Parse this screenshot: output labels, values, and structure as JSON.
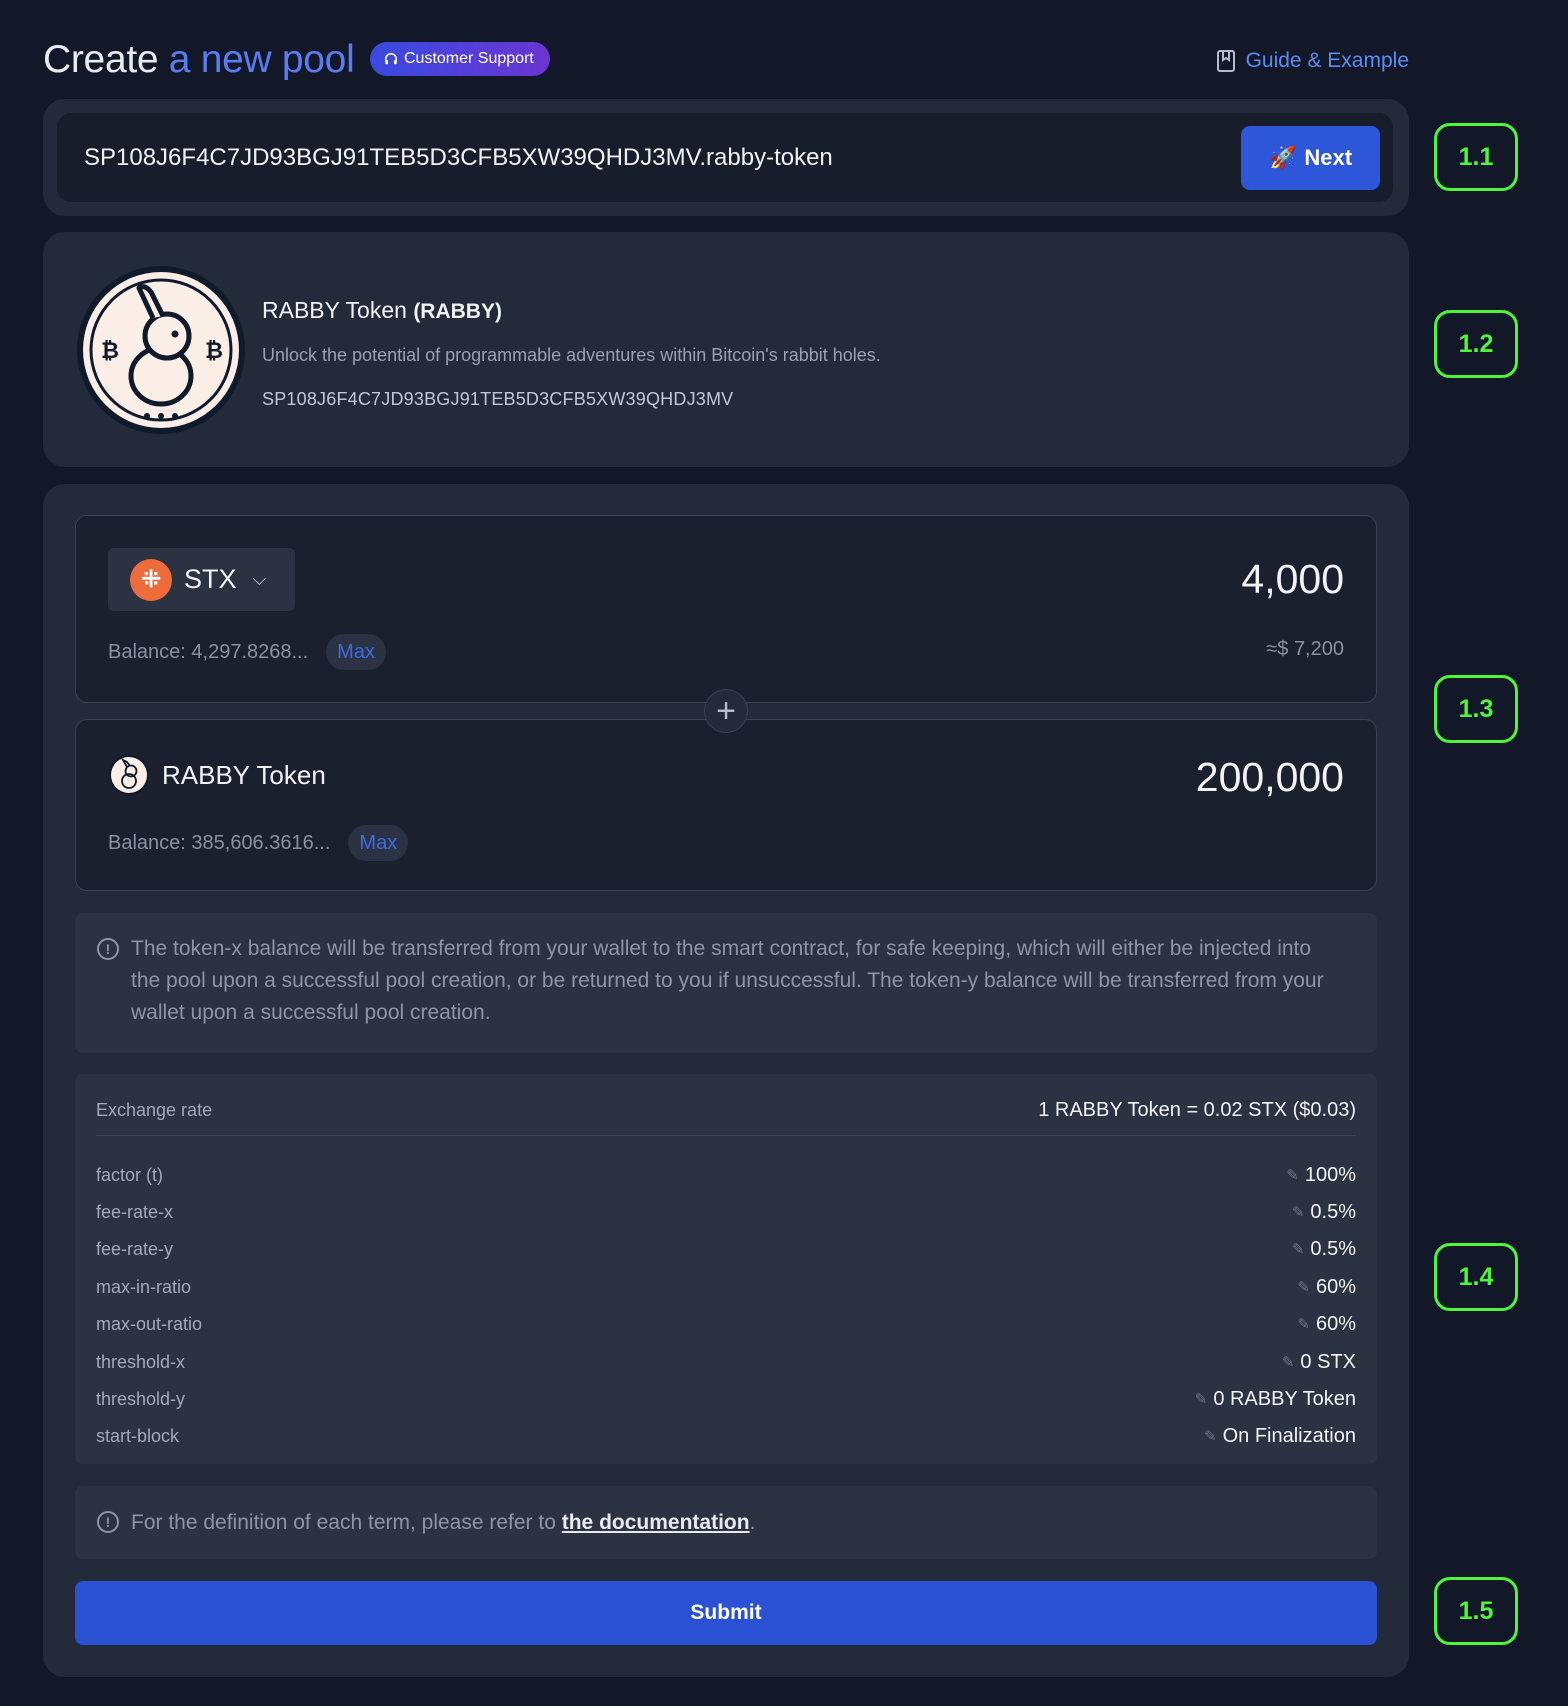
{
  "header": {
    "title_part1": "Create ",
    "title_part2": "a new pool",
    "support_label": "Customer Support",
    "guide_label": "Guide & Example"
  },
  "address_card": {
    "contract_value": "SP108J6F4C7JD93BGJ91TEB5D3CFB5XW39QHDJ3MV.rabby-token",
    "next_label": "Next"
  },
  "token_info": {
    "name": "RABBY Token",
    "symbol": "(RABBY)",
    "description": "Unlock the potential of programmable adventures within Bitcoin's rabbit holes.",
    "address": "SP108J6F4C7JD93BGJ91TEB5D3CFB5XW39QHDJ3MV"
  },
  "token_x": {
    "symbol": "STX",
    "amount": "4,000",
    "balance": "Balance: 4,297.8268...",
    "max_label": "Max",
    "usd_value": "≈$ 7,200"
  },
  "token_y": {
    "name": "RABBY Token",
    "amount": "200,000",
    "balance": "Balance: 385,606.3616...",
    "max_label": "Max"
  },
  "notice_transfer": "The token-x balance will be transferred from your wallet to the smart contract, for safe keeping, which will either be injected into the pool upon a successful pool creation, or be returned to you if unsuccessful. The token-y balance will be transferred from your wallet upon a successful pool creation.",
  "exchange": {
    "label": "Exchange rate",
    "value": "1 RABBY Token = 0.02 STX ($0.03)"
  },
  "params": [
    {
      "label": "factor (t)",
      "value": "100%"
    },
    {
      "label": "fee-rate-x",
      "value": "0.5%"
    },
    {
      "label": "fee-rate-y",
      "value": "0.5%"
    },
    {
      "label": "max-in-ratio",
      "value": "60%"
    },
    {
      "label": "max-out-ratio",
      "value": "60%"
    },
    {
      "label": "threshold-x",
      "value": "0 STX"
    },
    {
      "label": "threshold-y",
      "value": "0 RABBY Token"
    },
    {
      "label": "start-block",
      "value": "On Finalization"
    }
  ],
  "notice_doc": {
    "prefix": "For the definition of each term, please refer to ",
    "link": "the documentation",
    "suffix": "."
  },
  "submit_label": "Submit",
  "steps": [
    "1.1",
    "1.2",
    "1.3",
    "1.4",
    "1.5"
  ],
  "colors": {
    "background": "#121828",
    "card": "#232a39",
    "accent_blue": "#2d56d8",
    "step_green": "#4ff53c",
    "stx_orange": "#ee6b3c"
  }
}
